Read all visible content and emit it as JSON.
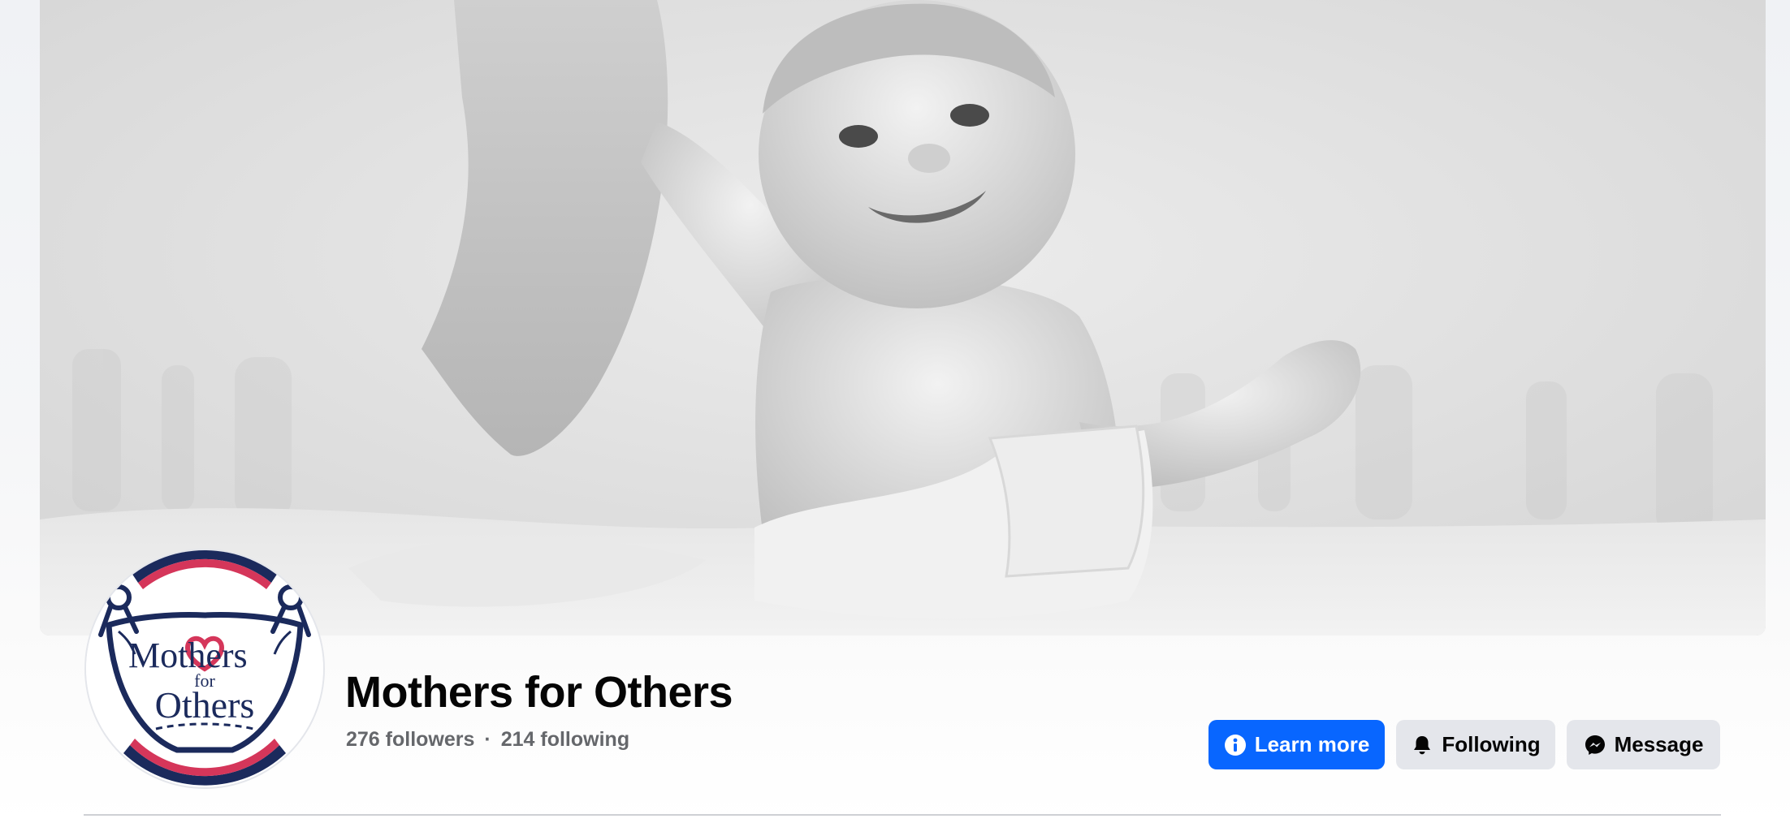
{
  "profile": {
    "name": "Mothers for Others",
    "followers": "276 followers",
    "separator": "·",
    "following": "214 following",
    "avatar_icon": "diaper-heart-logo",
    "logo_text": {
      "line1": "Mothers",
      "line2": "for",
      "line3": "Others"
    }
  },
  "actions": {
    "learn_more": {
      "label": "Learn more",
      "icon": "info-icon"
    },
    "following": {
      "label": "Following",
      "icon": "bell-icon"
    },
    "message": {
      "label": "Message",
      "icon": "messenger-icon"
    }
  },
  "cover": {
    "description_icon": "cover-photo"
  },
  "colors": {
    "primary_blue": "#0866ff",
    "secondary_button": "#e4e6eb",
    "logo_navy": "#1b2a5c",
    "logo_heart": "#d5365a",
    "text_primary": "#050505",
    "text_secondary": "#65676b"
  }
}
